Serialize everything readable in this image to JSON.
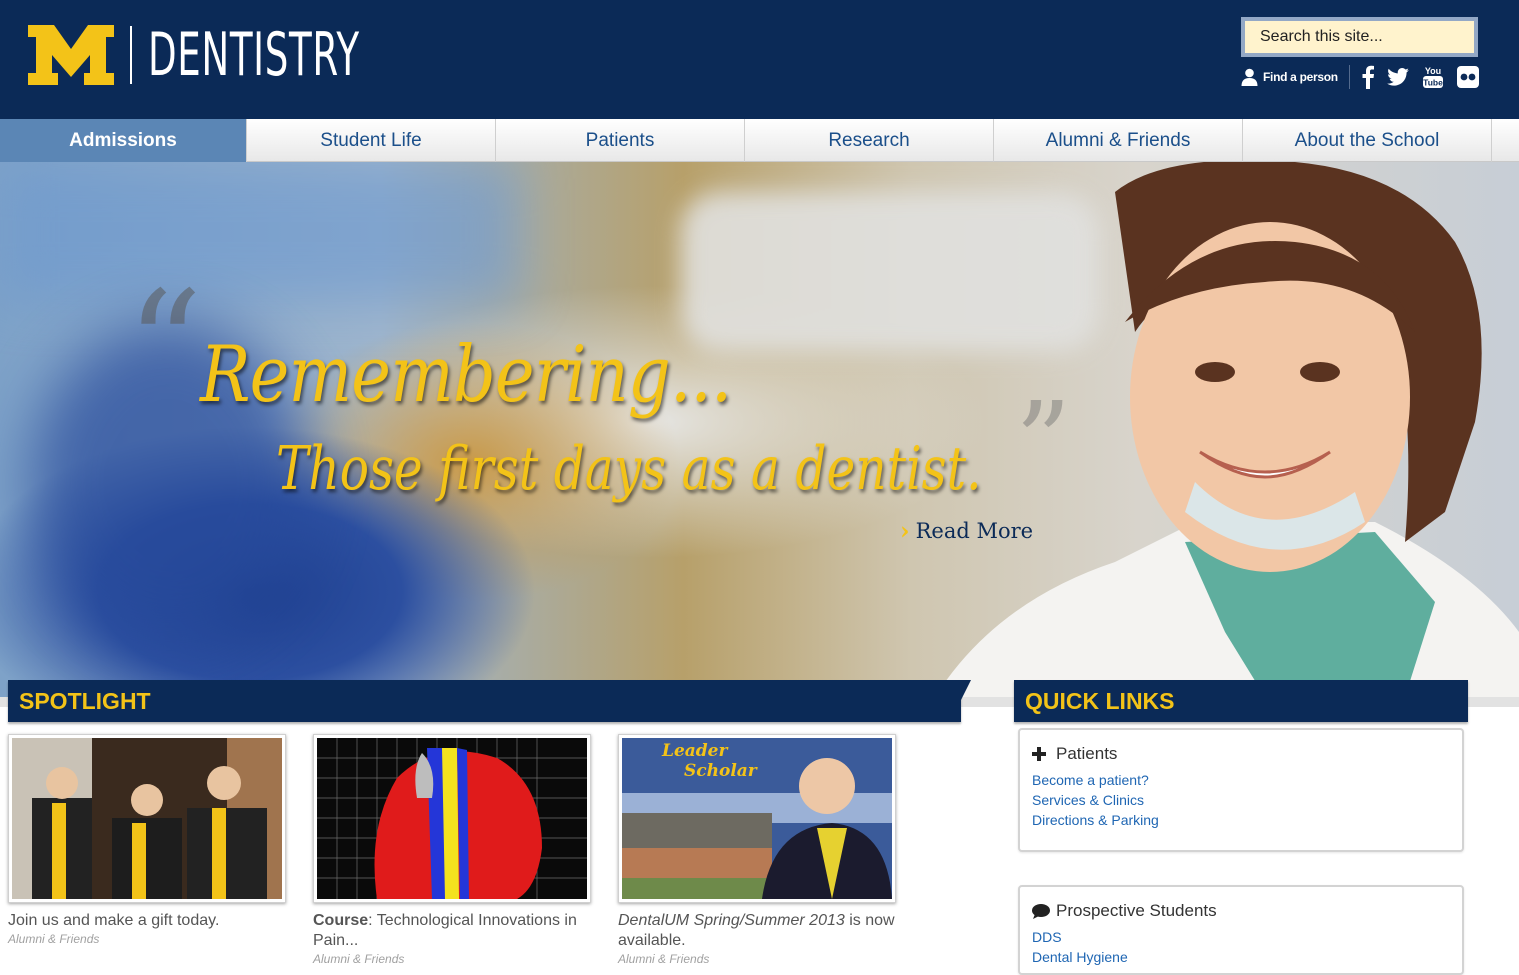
{
  "header": {
    "logo_mark": "M",
    "logo_text": "DENTISTRY",
    "search_placeholder": "Search this site...",
    "find_person": "Find a person",
    "social_icons": [
      "facebook-icon",
      "twitter-icon",
      "youtube-icon",
      "flickr-icon"
    ],
    "youtube_label_1": "You",
    "youtube_label_2": "Tube"
  },
  "nav": {
    "items": [
      {
        "label": "Admissions",
        "active": true
      },
      {
        "label": "Student Life"
      },
      {
        "label": "Patients"
      },
      {
        "label": "Research"
      },
      {
        "label": "Alumni & Friends"
      },
      {
        "label": "About the School"
      }
    ]
  },
  "hero": {
    "title": "Remembering...",
    "subtitle": "Those first days as a dentist.",
    "read_more": "Read More"
  },
  "spotlight": {
    "heading": "SPOTLIGHT",
    "cards": [
      {
        "text": "Join us and make a gift today.",
        "category": "Alumni & Friends"
      },
      {
        "bold": "Course",
        "text": ": Technological Innovations in Pain...",
        "category": "Alumni & Friends"
      },
      {
        "italic": "DentalUM Spring/Summer 2013",
        "text": " is now available.",
        "category": "Alumni & Friends",
        "thumb_label_1": "Leader",
        "thumb_label_2": "Scholar"
      }
    ]
  },
  "quick_links": {
    "heading": "QUICK LINKS",
    "groups": [
      {
        "title": "Patients",
        "links": [
          "Become a patient?",
          "Services & Clinics",
          "Directions & Parking"
        ]
      },
      {
        "title": "Prospective Students",
        "links": [
          "DDS",
          "Dental Hygiene"
        ]
      }
    ]
  },
  "colors": {
    "navy": "#0b2a57",
    "maize": "#f3c318",
    "nav_active": "#5b86b5",
    "link": "#1f66b3"
  }
}
